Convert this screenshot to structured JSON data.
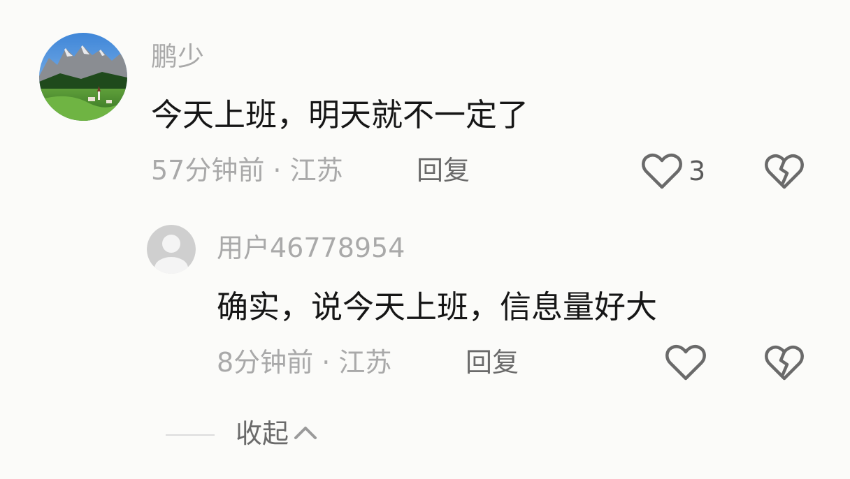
{
  "comment": {
    "username": "鹏少",
    "text": "今天上班，明天就不一定了",
    "meta": "57分钟前 · 江苏",
    "reply_label": "回复",
    "like_count": "3"
  },
  "reply": {
    "username": "用户46778954",
    "text": "确实，说今天上班，信息量好大",
    "meta": "8分钟前 · 江苏",
    "reply_label": "回复"
  },
  "collapse": {
    "label": "收起"
  },
  "icons": {
    "like": "heart-outline-icon",
    "dislike": "broken-heart-icon",
    "collapse": "chevron-up-icon",
    "default_avatar": "user-icon"
  }
}
